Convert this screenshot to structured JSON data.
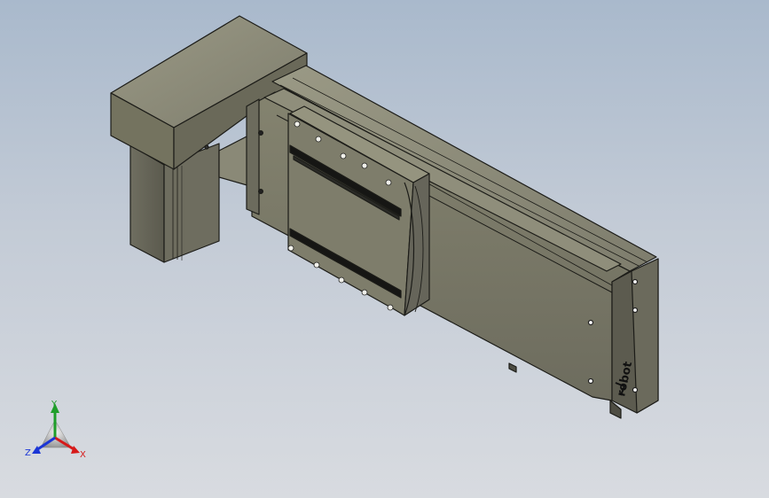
{
  "viewport": {
    "background_top": "#a9b9cc",
    "background_bottom": "#d8dbe0"
  },
  "model": {
    "body_color": "#7d7c6c",
    "edge_color": "#1c1c18",
    "brand_text": "robot",
    "logo_icon": "brand-logo-icon"
  },
  "triad": {
    "x_label": "X",
    "y_label": "Y",
    "z_label": "Z",
    "x_color": "#d61a1a",
    "y_color": "#1f9e2a",
    "z_color": "#1b36d6"
  }
}
